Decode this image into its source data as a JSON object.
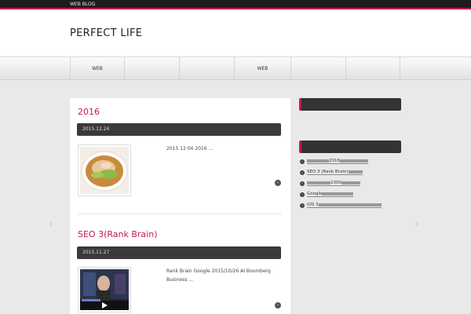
{
  "topbar": {
    "text": "WEB BLOG"
  },
  "header": {
    "logo": "PERFECT LIFE"
  },
  "nav": {
    "items": [
      {
        "label": "WEB"
      },
      {
        "label": ""
      },
      {
        "label": ""
      },
      {
        "label": "WEB"
      },
      {
        "label": ""
      },
      {
        "label": ""
      }
    ]
  },
  "posts": [
    {
      "title_pre": "",
      "title_num": "2016",
      "title_post": "",
      "date": "2015.12.24",
      "excerpt": "2015 12 04 2016 ...",
      "more_label": ""
    },
    {
      "title_pre": "SEO 3",
      "title_num": "(Rank Brain)",
      "title_post": "",
      "date": "2015.11.27",
      "excerpt": "Rank Brain Google 2015/10/26 AI Boomberg Business ...",
      "more_label": "",
      "video_caption": "Bloomberg"
    }
  ],
  "sidebar": {
    "profile_head": "",
    "profile_text": "",
    "recent_head": "",
    "recent": [
      {
        "label": "2016"
      },
      {
        "label": "SEO 3 (Rank Brain)"
      },
      {
        "label": "1000"
      },
      {
        "label": "Google"
      },
      {
        "label": "iOS 3"
      }
    ]
  },
  "colors": {
    "accent": "#c2185b",
    "dark_bar": "#3a3a3a",
    "background": "#e9e9e9"
  },
  "icons": {
    "more": "chevron-right-icon",
    "bullet": "chevron-right-icon",
    "play": "play-icon"
  }
}
